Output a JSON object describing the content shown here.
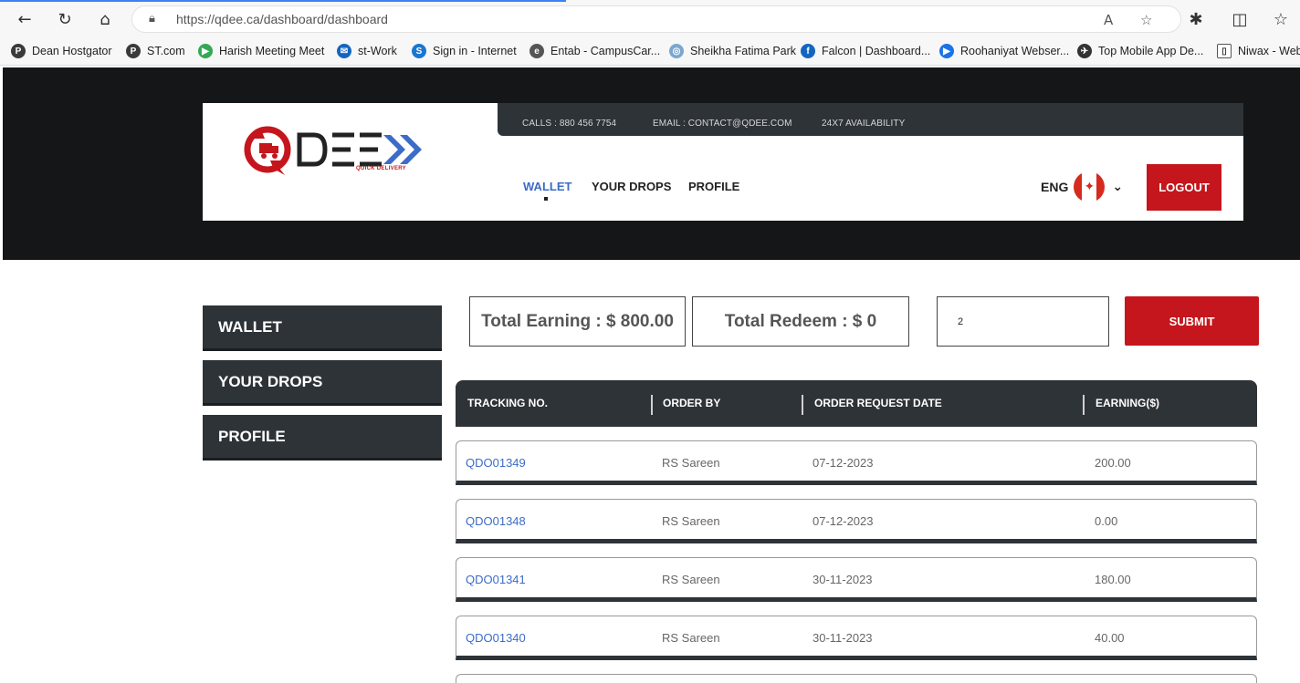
{
  "browser": {
    "url": "https://qdee.ca/dashboard/dashboard",
    "bookmarks": [
      {
        "label": "Dean Hostgator",
        "color": "#3a3a3a",
        "glyph": "P"
      },
      {
        "label": "ST.com",
        "color": "#3a3a3a",
        "glyph": "P"
      },
      {
        "label": "Harish Meeting Meet",
        "color": "#34a853",
        "glyph": "▶"
      },
      {
        "label": "st-Work",
        "color": "#1565c0",
        "glyph": "✉"
      },
      {
        "label": "Sign in - Internet",
        "color": "#1976d2",
        "glyph": "S"
      },
      {
        "label": "Entab - CampusCar...",
        "color": "#555555",
        "glyph": "e"
      },
      {
        "label": "Sheikha Fatima Park",
        "color": "#7aa7cf",
        "glyph": "◎"
      },
      {
        "label": "Falcon | Dashboard...",
        "color": "#1565c0",
        "glyph": "f"
      },
      {
        "label": "Roohaniyat Webser...",
        "color": "#1a73e8",
        "glyph": "▶"
      },
      {
        "label": "Top Mobile App De...",
        "color": "#333333",
        "glyph": "✈"
      },
      {
        "label": "Niwax - Web",
        "color": "#ffffff",
        "glyph": "▯"
      }
    ]
  },
  "header": {
    "calls": "CALLS : 880 456 7754",
    "email": "EMAIL :  CONTACT@QDEE.COM",
    "availability": "24X7 AVAILABILITY",
    "logo_tagline": "QUICK DELIVERY",
    "nav": {
      "wallet": "WALLET",
      "drops": "YOUR DROPS",
      "profile": "PROFILE"
    },
    "lang": "ENG",
    "logout": "LOGOUT"
  },
  "sidebar": {
    "wallet": "WALLET",
    "drops": "YOUR DROPS",
    "profile": "PROFILE"
  },
  "summary": {
    "total_earning": "Total Earning : $ 800.00",
    "total_redeem": "Total Redeem : $ 0",
    "redeem_value": "2",
    "submit": "SUBMIT"
  },
  "table": {
    "headers": [
      "TRACKING NO.",
      "ORDER BY",
      "ORDER REQUEST DATE",
      "EARNING($)"
    ],
    "rows": [
      [
        "QDO01349",
        "RS Sareen",
        "07-12-2023",
        "200.00"
      ],
      [
        "QDO01348",
        "RS Sareen",
        "07-12-2023",
        "0.00"
      ],
      [
        "QDO01341",
        "RS Sareen",
        "30-11-2023",
        "180.00"
      ],
      [
        "QDO01340",
        "RS Sareen",
        "30-11-2023",
        "40.00"
      ]
    ]
  },
  "colors": {
    "accent_red": "#c4161c",
    "dark": "#2e3338",
    "link_blue": "#3c6cc7"
  }
}
